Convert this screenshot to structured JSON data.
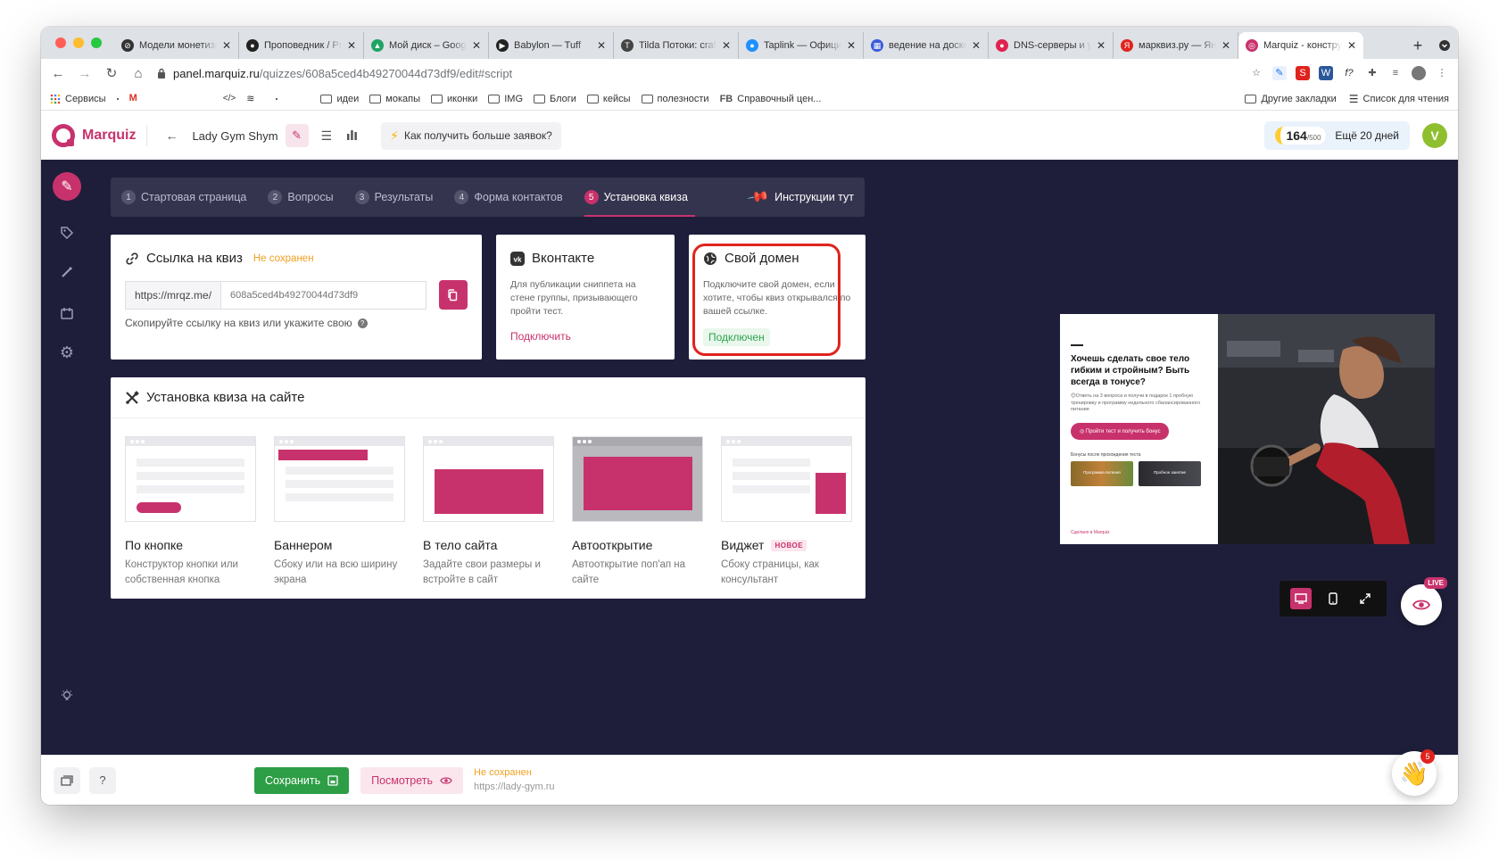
{
  "browser": {
    "tabs": [
      {
        "title": "Модели монетиза",
        "color": "#333333",
        "glyph": "⊘"
      },
      {
        "title": "Проповедник / Pr",
        "color": "#222222",
        "glyph": "●"
      },
      {
        "title": "Мой диск – Googl",
        "color": "#1fa463",
        "glyph": "▲"
      },
      {
        "title": "Babylon — Tuff",
        "color": "#222222",
        "glyph": "▶"
      },
      {
        "title": "Tilda Потоки: craf",
        "color": "#444444",
        "glyph": "T"
      },
      {
        "title": "Taplink — Официа",
        "color": "#1e90ff",
        "glyph": "●"
      },
      {
        "title": "ведение на доске",
        "color": "#3b5bdb",
        "glyph": "▦"
      },
      {
        "title": "DNS-серверы и у",
        "color": "#e0234e",
        "glyph": "●"
      },
      {
        "title": "марквиз.ру — Янд",
        "color": "#e0231e",
        "glyph": "Я"
      },
      {
        "title": "Marquiz - констру",
        "color": "#c8326c",
        "glyph": "◎"
      }
    ],
    "url_host": "panel.marquiz.ru",
    "url_path": "/quizzes/608a5ced4b49270044d73df9/edit#script",
    "bookmarks": [
      "Сервисы",
      "идеи",
      "мокапы",
      "иконки",
      "IMG",
      "Блоги",
      "кейсы",
      "полезности",
      "Справочный цен..."
    ],
    "bookmarks_right": [
      "Другие закладки",
      "Список для чтения"
    ],
    "fb_label": "FB"
  },
  "header": {
    "logo": "Marquiz",
    "project": "Lady Gym Shym",
    "tip": "Как получить больше заявок?",
    "credits": "164",
    "credits_max": "/500",
    "days": "Ещё 20 дней",
    "avatar": "V"
  },
  "steps": [
    {
      "num": "1",
      "label": "Стартовая страница",
      "active": false
    },
    {
      "num": "2",
      "label": "Вопросы",
      "active": false
    },
    {
      "num": "3",
      "label": "Результаты",
      "active": false
    },
    {
      "num": "4",
      "label": "Форма контактов",
      "active": false
    },
    {
      "num": "5",
      "label": "Установка квиза",
      "active": true
    }
  ],
  "instructions": "Инструкции тут",
  "link_card": {
    "title": "Ссылка на квиз",
    "status": "Не сохранен",
    "prefix": "https://mrqz.me/",
    "slug_placeholder": "608a5ced4b49270044d73df9",
    "hint": "Скопируйте ссылку на квиз или укажите свою"
  },
  "vk_card": {
    "title": "Вконтакте",
    "desc": "Для публикации сниппета на стене группы, призывающего пройти тест.",
    "action": "Подключить"
  },
  "domain_card": {
    "title": "Свой домен",
    "desc": "Подключите свой домен, если хотите, чтобы квиз открывался по вашей ссылке.",
    "status": "Подключен"
  },
  "install": {
    "title": "Установка квиза на сайте",
    "new_badge": "НОВОЕ",
    "options": [
      {
        "title": "По кнопке",
        "desc": "Конструктор кнопки или собственная кнопка"
      },
      {
        "title": "Баннером",
        "desc": "Сбоку или на всю ширину экрана"
      },
      {
        "title": "В тело сайта",
        "desc": "Задайте свои размеры и встройте в сайт"
      },
      {
        "title": "Автооткрытие",
        "desc": "Автооткрытие поп'ап на сайте"
      },
      {
        "title": "Виджет",
        "desc": "Сбоку страницы, как консультант"
      }
    ]
  },
  "preview": {
    "title": "Хочешь сделать свое тело гибким и стройным? Быть всегда в тонусе?",
    "sub": "😊Ответь на 3 вопроса и получи в подарок 1 пробную тренировку и программу недельного сбалансированного питания",
    "cta": "◎ Пройти тест и получить бонус",
    "bonus_title": "Бонусы после прохождения теста",
    "bonus1": "Программа питания",
    "bonus2": "Пробное занятие",
    "footer": "Сделано в Marquiz",
    "live": "LIVE"
  },
  "footer": {
    "save": "Сохранить",
    "view": "Посмотреть",
    "status": "Не сохранен",
    "url": "https://lady-gym.ru",
    "help": "?",
    "notif": "5"
  },
  "colors": {
    "brand": "#c8326c",
    "dark_bg": "#1f1e3a",
    "save_green": "#2e9e46",
    "warn": "#f0a020",
    "ok_green": "#2da44e",
    "highlight": "#e0231e"
  }
}
